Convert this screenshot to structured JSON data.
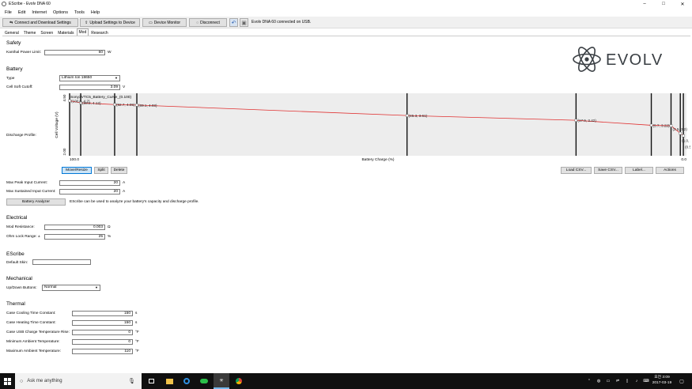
{
  "window": {
    "title": "EScribe - Evolv DNA 60",
    "controls": {
      "minimize": "–",
      "maximize": "□",
      "close": "✕"
    }
  },
  "menu": [
    "File",
    "Edit",
    "Internet",
    "Options",
    "Tools",
    "Help"
  ],
  "toolbar": {
    "connect_label": "Connect and Download Settings",
    "upload_label": "Upload Settings to Device",
    "monitor_label": "Device Monitor",
    "disconnect_label": "Disconnect",
    "status": "Evolv DNA 60 connected on USB."
  },
  "tabs": [
    "General",
    "Theme",
    "Screen",
    "Materials",
    "Mod",
    "Research"
  ],
  "active_tab": "Mod",
  "logo": {
    "text": "EVOLV",
    "color": "#3a3f44"
  },
  "safety": {
    "title": "Safety",
    "kanthal_label": "Kanthal Power Limit:",
    "kanthal_value": "60",
    "kanthal_unit": "W"
  },
  "battery": {
    "title": "Battery",
    "type_label": "Type",
    "type_value": "Lithium Ion 18650",
    "cutoff_label": "Cell Soft Cutoff:",
    "cutoff_value": "3.09",
    "cutoff_unit": "V",
    "discharge_label": "Discharge Profile:",
    "buttons": {
      "move": "Move/Resize",
      "split": "Split",
      "delete": "Delete",
      "load": "Load CSV...",
      "save": "Save CSV...",
      "label": "Label...",
      "actions": "Actions"
    },
    "peak_label": "Max Peak Input Current:",
    "peak_value": "20",
    "peak_unit": "A",
    "sustained_label": "Max Sustained Input Current:",
    "sustained_value": "20",
    "sustained_unit": "A",
    "analyzer_label": "Battery Analyzer",
    "analyzer_desc": "EScribe can be used to analyze your battery's capacity and discharge profile."
  },
  "electrical": {
    "title": "Electrical",
    "resistance_label": "Mod Resistance:",
    "resistance_value": "0.003",
    "resistance_unit": "Ω",
    "ohm_label": "Ohm Lock Range: ±",
    "ohm_value": "25",
    "ohm_unit": "%"
  },
  "escribe": {
    "title": "EScribe",
    "skin_label": "Default Skin:",
    "skin_value": ""
  },
  "mechanical": {
    "title": "Mechanical",
    "updown_label": "Up/Down Buttons:",
    "updown_value": "Normal"
  },
  "thermal": {
    "title": "Thermal",
    "rows": [
      {
        "label": "Case Cooling Time Constant:",
        "value": "150",
        "unit": "s"
      },
      {
        "label": "Case Heating Time Constant:",
        "value": "150",
        "unit": "s"
      },
      {
        "label": "Case USB Charge Temperature Rise:",
        "value": "0",
        "unit": "°F"
      },
      {
        "label": "Minimum Ambient Temperature:",
        "value": "0",
        "unit": "°F"
      },
      {
        "label": "Maximum Ambient Temperature:",
        "value": "110",
        "unit": "°F"
      }
    ]
  },
  "chart_data": {
    "type": "line",
    "title": "Sony3VTC5_Battery_Curve_(0.100)",
    "xlabel": "Battery Charge (%)",
    "ylabel": "Cell Voltage (V)",
    "xlim": [
      100,
      0
    ],
    "ylim": [
      2.0,
      4.5
    ],
    "x_tick_labels": [
      "100.0",
      "0.0"
    ],
    "y_tick_labels": [
      "4.50",
      "2.00"
    ],
    "line_color": "#e03030",
    "points": [
      {
        "x": 100.0,
        "y": 4.2,
        "label": "(100.0, 4.2)"
      },
      {
        "x": 98.2,
        "y": 4.12,
        "label": "(98.2, 4.12)"
      },
      {
        "x": 92.7,
        "y": 4.05,
        "label": "(92.7, 4.05)"
      },
      {
        "x": 89.1,
        "y": 4.03,
        "label": "(89.1, 4.03)"
      },
      {
        "x": 45.3,
        "y": 3.61,
        "label": "(45.3, 3.61)"
      },
      {
        "x": 17.9,
        "y": 3.42,
        "label": "(17.9, 3.42)"
      },
      {
        "x": 5.7,
        "y": 3.22,
        "label": "(5.7, 3.22)"
      },
      {
        "x": 2.5,
        "y": 3.2,
        "label": "(2.5, 3.2)"
      },
      {
        "x": 1.0,
        "y": 2.9,
        "label": "(1.0, 2.9)"
      },
      {
        "x": 0.5,
        "y": 2.8,
        "label": "(0.5, 2.8)"
      }
    ]
  },
  "taskbar": {
    "search_placeholder": "Ask me anything",
    "time": "오전 3:09",
    "date": "2017-03-19"
  }
}
